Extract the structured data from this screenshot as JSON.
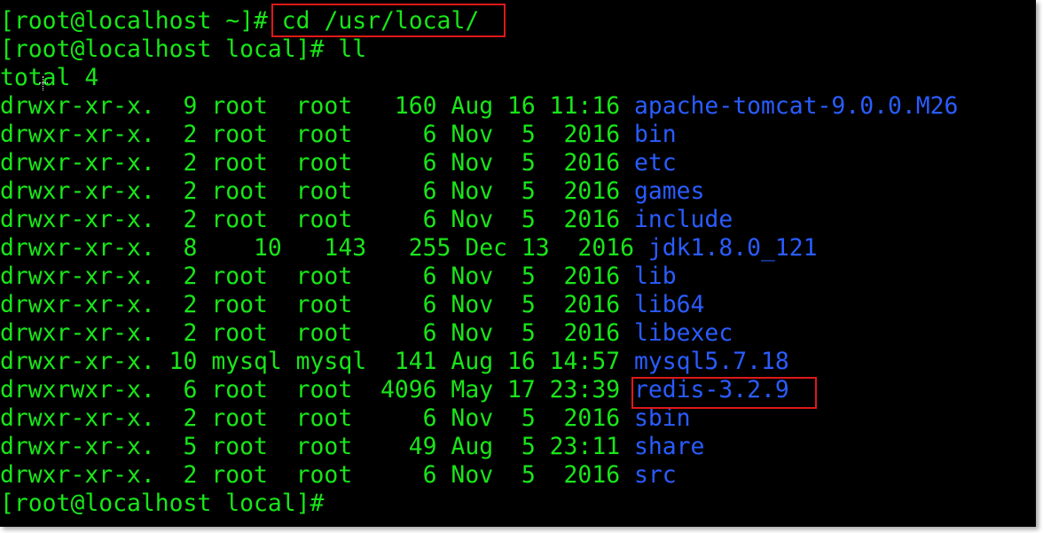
{
  "prompt_cd": "[root@localhost ~]# ",
  "cmd_cd": "cd /usr/local/",
  "prompt_ll": "[root@localhost local]# ll",
  "total": "total 4",
  "entries": [
    {
      "meta": "drwxr-xr-x.  9 root  root   160 Aug 16 11:16 ",
      "name": "apache-tomcat-9.0.0.M26"
    },
    {
      "meta": "drwxr-xr-x.  2 root  root     6 Nov  5  2016 ",
      "name": "bin"
    },
    {
      "meta": "drwxr-xr-x.  2 root  root     6 Nov  5  2016 ",
      "name": "etc"
    },
    {
      "meta": "drwxr-xr-x.  2 root  root     6 Nov  5  2016 ",
      "name": "games"
    },
    {
      "meta": "drwxr-xr-x.  2 root  root     6 Nov  5  2016 ",
      "name": "include"
    },
    {
      "meta": "drwxr-xr-x.  8    10   143   255 Dec 13  2016 ",
      "name": "jdk1.8.0_121"
    },
    {
      "meta": "drwxr-xr-x.  2 root  root     6 Nov  5  2016 ",
      "name": "lib"
    },
    {
      "meta": "drwxr-xr-x.  2 root  root     6 Nov  5  2016 ",
      "name": "lib64"
    },
    {
      "meta": "drwxr-xr-x.  2 root  root     6 Nov  5  2016 ",
      "name": "libexec"
    },
    {
      "meta": "drwxr-xr-x. 10 mysql mysql  141 Aug 16 14:57 ",
      "name": "mysql5.7.18"
    },
    {
      "meta": "drwxrwxr-x.  6 root  root  4096 May 17 23:39 ",
      "name": "redis-3.2.9"
    },
    {
      "meta": "drwxr-xr-x.  2 root  root     6 Nov  5  2016 ",
      "name": "sbin"
    },
    {
      "meta": "drwxr-xr-x.  5 root  root    49 Aug  5 23:11 ",
      "name": "share"
    },
    {
      "meta": "drwxr-xr-x.  2 root  root     6 Nov  5  2016 ",
      "name": "src"
    }
  ],
  "prompt_last": "[root@localhost local]#",
  "colors": {
    "background": "#000000",
    "text": "#19e619",
    "directory": "#2a5cff",
    "highlight": "#e01818"
  }
}
